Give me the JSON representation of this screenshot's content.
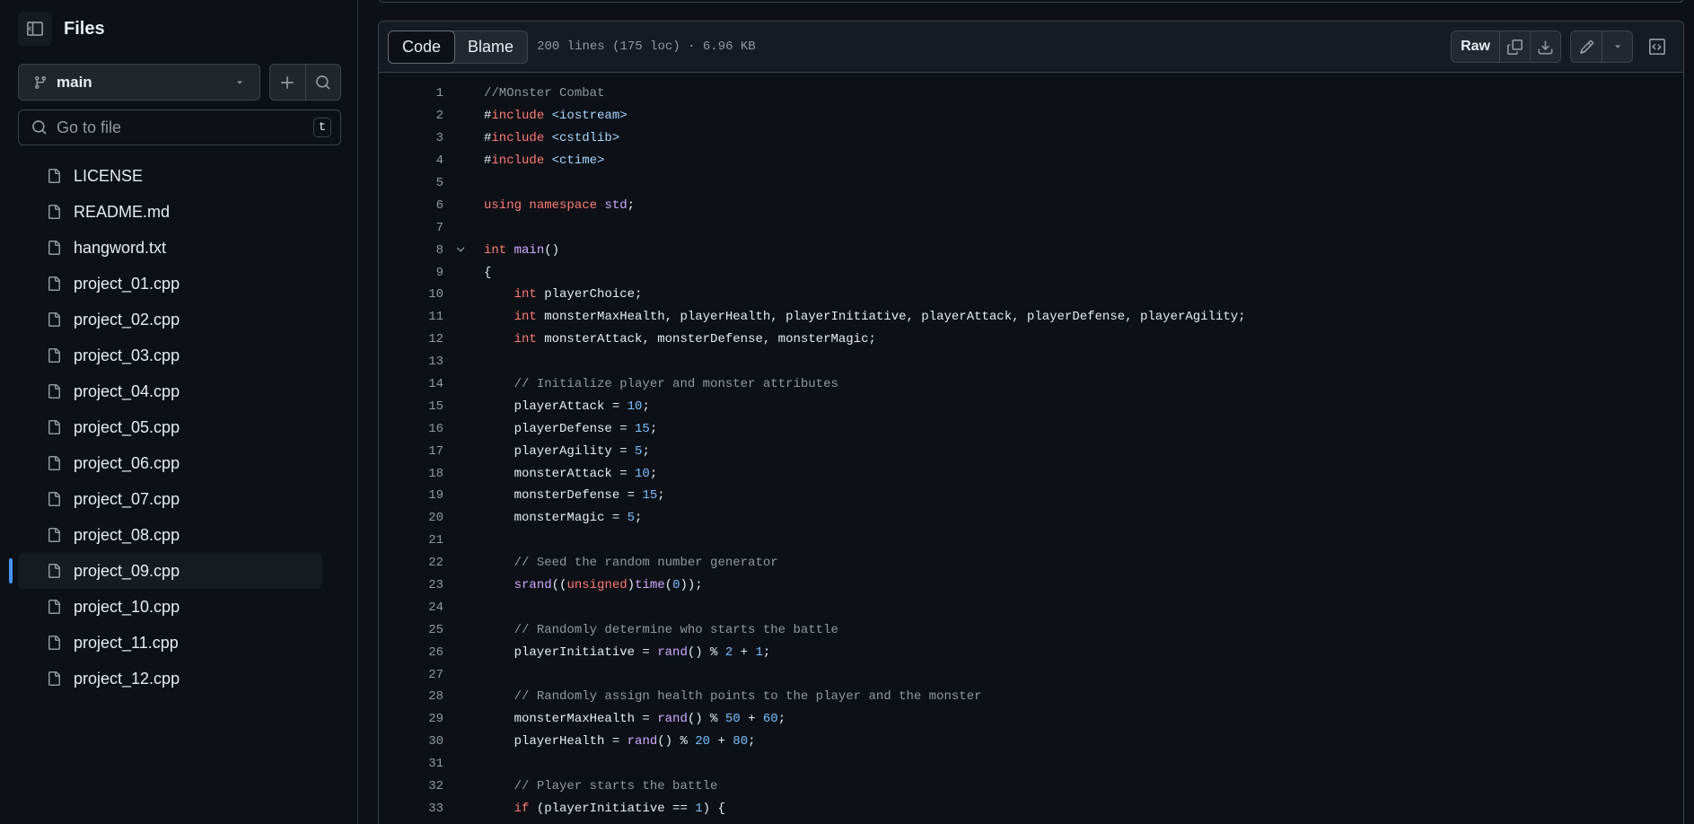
{
  "sidebar": {
    "title": "Files",
    "branch": "main",
    "search_placeholder": "Go to file",
    "search_shortcut": "t",
    "files": [
      "LICENSE",
      "README.md",
      "hangword.txt",
      "project_01.cpp",
      "project_02.cpp",
      "project_03.cpp",
      "project_04.cpp",
      "project_05.cpp",
      "project_06.cpp",
      "project_07.cpp",
      "project_08.cpp",
      "project_09.cpp",
      "project_10.cpp",
      "project_11.cpp",
      "project_12.cpp"
    ],
    "active_file": "project_09.cpp"
  },
  "toolbar": {
    "code_tab": "Code",
    "blame_tab": "Blame",
    "file_meta": "200 lines (175 loc) · 6.96 KB",
    "raw_label": "Raw"
  },
  "code_lines": [
    {
      "n": "1",
      "t": "//MOnster Combat"
    },
    {
      "n": "2",
      "t": "#include <iostream>"
    },
    {
      "n": "3",
      "t": "#include <cstdlib>"
    },
    {
      "n": "4",
      "t": "#include <ctime>"
    },
    {
      "n": "5",
      "t": ""
    },
    {
      "n": "6",
      "t": "using namespace std;"
    },
    {
      "n": "7",
      "t": ""
    },
    {
      "n": "8",
      "t": "int main()"
    },
    {
      "n": "9",
      "t": "{"
    },
    {
      "n": "10",
      "t": "    int playerChoice;"
    },
    {
      "n": "11",
      "t": "    int monsterMaxHealth, playerHealth, playerInitiative, playerAttack, playerDefense, playerAgility;"
    },
    {
      "n": "12",
      "t": "    int monsterAttack, monsterDefense, monsterMagic;"
    },
    {
      "n": "13",
      "t": ""
    },
    {
      "n": "14",
      "t": "    // Initialize player and monster attributes"
    },
    {
      "n": "15",
      "t": "    playerAttack = 10;"
    },
    {
      "n": "16",
      "t": "    playerDefense = 15;"
    },
    {
      "n": "17",
      "t": "    playerAgility = 5;"
    },
    {
      "n": "18",
      "t": "    monsterAttack = 10;"
    },
    {
      "n": "19",
      "t": "    monsterDefense = 15;"
    },
    {
      "n": "20",
      "t": "    monsterMagic = 5;"
    },
    {
      "n": "21",
      "t": ""
    },
    {
      "n": "22",
      "t": "    // Seed the random number generator"
    },
    {
      "n": "23",
      "t": "    srand((unsigned)time(0));"
    },
    {
      "n": "24",
      "t": ""
    },
    {
      "n": "25",
      "t": "    // Randomly determine who starts the battle"
    },
    {
      "n": "26",
      "t": "    playerInitiative = rand() % 2 + 1;"
    },
    {
      "n": "27",
      "t": ""
    },
    {
      "n": "28",
      "t": "    // Randomly assign health points to the player and the monster"
    },
    {
      "n": "29",
      "t": "    monsterMaxHealth = rand() % 50 + 60;"
    },
    {
      "n": "30",
      "t": "    playerHealth = rand() % 20 + 80;"
    },
    {
      "n": "31",
      "t": ""
    },
    {
      "n": "32",
      "t": "    // Player starts the battle"
    },
    {
      "n": "33",
      "t": "    if (playerInitiative == 1) {"
    }
  ],
  "colors": {
    "background": "#0d1117",
    "accent": "#4493f8",
    "keyword": "#ff7b72",
    "function": "#d2a8ff",
    "string": "#a5d6ff",
    "number": "#79c0ff",
    "comment": "#9198a1"
  },
  "icons": {
    "panel_toggle": "sidebar-collapse-icon",
    "branch": "git-branch-icon",
    "add": "plus-icon",
    "search": "search-icon",
    "file": "file-icon",
    "copy": "copy-icon",
    "download": "download-icon",
    "edit": "pencil-icon",
    "more": "triangle-down-icon",
    "symbols": "code-square-icon",
    "fold": "chevron-down-icon"
  }
}
